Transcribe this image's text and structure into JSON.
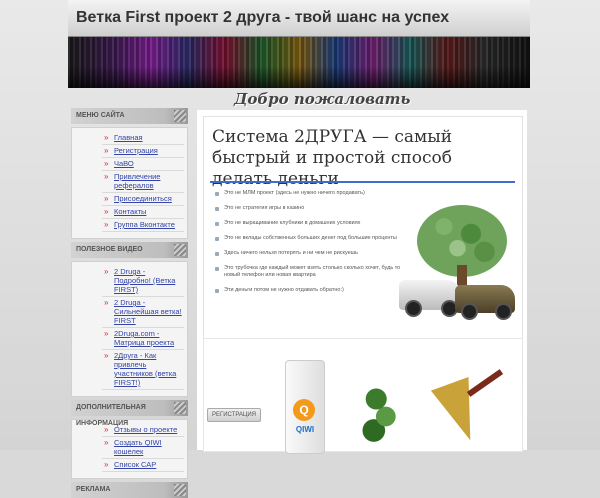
{
  "header": {
    "title": "Ветка First проект 2 друга - твой шанс на успех"
  },
  "welcome": "Добро пожаловать",
  "sidebar": {
    "sections": [
      {
        "title": "МЕНЮ САЙТА",
        "items": [
          "Главная",
          "Регистрация",
          "ЧаВО",
          "Привлечение рефералов",
          "Присоединиться",
          "Контакты",
          "Группа Вконтакте"
        ]
      },
      {
        "title": "ПОЛЕЗНОЕ ВИДЕО",
        "items": [
          "2 Druga - Подробно! (Ветка FIRST)",
          "2 Druga - Сильнейшая ветка! FIRST",
          "2Druga.com - Матрица проекта",
          "2Друга - Как привлечь участников (ветка FIRST!)"
        ]
      },
      {
        "title": "ДОПОЛНИТЕЛЬНАЯ ИНФОРМАЦИЯ",
        "items": [
          "Отзывы о проекте",
          "Создать QIWI кошелек",
          "Список САР"
        ]
      },
      {
        "title": "РЕКЛАМА",
        "items": []
      }
    ]
  },
  "banner": {
    "title": "Система 2ДРУГА — самый быстрый и простой способ делать деньги",
    "bullets": [
      "Это не МЛМ проект (здесь не нужно ничего продавать)",
      "Это не стратегия игры в казино",
      "Это не выращивание клубники в домашних условиях",
      "Это не вклады собственных больших денег под большие проценты",
      "Здесь ничего нельзя потерять и ни чем не рискуешь",
      "Это трубочка где каждый может взять столько сколько хочет, будь то новый телефон или новая квартира",
      "Эти деньги потом не нужно отдавать обратно:)"
    ]
  },
  "lower": {
    "register_label": "РЕГИСТРАЦИЯ",
    "qiwi_label": "QIWI",
    "qiwi_letter": "Q"
  }
}
